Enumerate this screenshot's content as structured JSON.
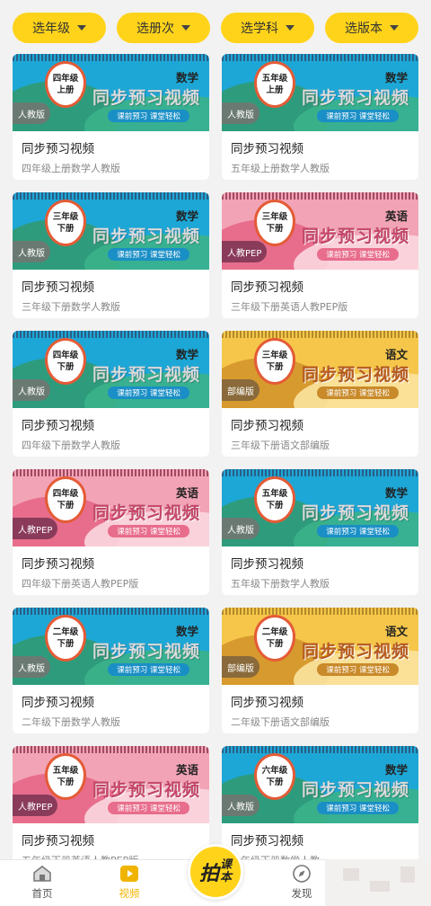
{
  "filters": [
    {
      "label": "选年级"
    },
    {
      "label": "选册次"
    },
    {
      "label": "选学科"
    },
    {
      "label": "选版本"
    }
  ],
  "cards": [
    {
      "theme": "blue",
      "grade": "四年级",
      "term": "上册",
      "subject": "数学",
      "edition": "人教版",
      "banner_title": "同步预习视频",
      "slogan": "课前预习 课堂轻松",
      "title": "同步预习视频",
      "subtitle": "四年级上册数学人教版"
    },
    {
      "theme": "blue",
      "grade": "五年级",
      "term": "上册",
      "subject": "数学",
      "edition": "人教版",
      "banner_title": "同步预习视频",
      "slogan": "课前预习 课堂轻松",
      "title": "同步预习视频",
      "subtitle": "五年级上册数学人教版"
    },
    {
      "theme": "blue",
      "grade": "三年级",
      "term": "下册",
      "subject": "数学",
      "edition": "人教版",
      "banner_title": "同步预习视频",
      "slogan": "课前预习 课堂轻松",
      "title": "同步预习视频",
      "subtitle": "三年级下册数学人教版"
    },
    {
      "theme": "pink",
      "grade": "三年级",
      "term": "下册",
      "subject": "英语",
      "edition": "人教PEP",
      "banner_title": "同步预习视频",
      "slogan": "课前预习 课堂轻松",
      "title": "同步预习视频",
      "subtitle": "三年级下册英语人教PEP版"
    },
    {
      "theme": "blue",
      "grade": "四年级",
      "term": "下册",
      "subject": "数学",
      "edition": "人教版",
      "banner_title": "同步预习视频",
      "slogan": "课前预习 课堂轻松",
      "title": "同步预习视频",
      "subtitle": "四年级下册数学人教版"
    },
    {
      "theme": "yellow",
      "grade": "三年级",
      "term": "下册",
      "subject": "语文",
      "edition": "部编版",
      "banner_title": "同步预习视频",
      "slogan": "课前预习 课堂轻松",
      "title": "同步预习视频",
      "subtitle": "三年级下册语文部编版"
    },
    {
      "theme": "pink",
      "grade": "四年级",
      "term": "下册",
      "subject": "英语",
      "edition": "人教PEP",
      "banner_title": "同步预习视频",
      "slogan": "课前预习 课堂轻松",
      "title": "同步预习视频",
      "subtitle": "四年级下册英语人教PEP版"
    },
    {
      "theme": "blue",
      "grade": "五年级",
      "term": "下册",
      "subject": "数学",
      "edition": "人教版",
      "banner_title": "同步预习视频",
      "slogan": "课前预习 课堂轻松",
      "title": "同步预习视频",
      "subtitle": "五年级下册数学人教版"
    },
    {
      "theme": "blue",
      "grade": "二年级",
      "term": "下册",
      "subject": "数学",
      "edition": "人教版",
      "banner_title": "同步预习视频",
      "slogan": "课前预习 课堂轻松",
      "title": "同步预习视频",
      "subtitle": "二年级下册数学人教版"
    },
    {
      "theme": "yellow",
      "grade": "二年级",
      "term": "下册",
      "subject": "语文",
      "edition": "部编版",
      "banner_title": "同步预习视频",
      "slogan": "课前预习 课堂轻松",
      "title": "同步预习视频",
      "subtitle": "二年级下册语文部编版"
    },
    {
      "theme": "pink",
      "grade": "五年级",
      "term": "下册",
      "subject": "英语",
      "edition": "人教PEP",
      "banner_title": "同步预习视频",
      "slogan": "课前预习 课堂轻松",
      "title": "同步预习视频",
      "subtitle": "五年级下册英语人教PEP版"
    },
    {
      "theme": "blue",
      "grade": "六年级",
      "term": "下册",
      "subject": "数学",
      "edition": "人教版",
      "banner_title": "同步预习视频",
      "slogan": "课前预习 课堂轻松",
      "title": "同步预习视频",
      "subtitle": "六年级下册数学人教"
    }
  ],
  "bottom_nav": {
    "home_label": "首页",
    "video_label": "视频",
    "center_label_main": "拍",
    "center_label_side": "课",
    "center_label_side2": "本",
    "find_label": "发现"
  },
  "colors": {
    "accent_yellow": "#ffd31a",
    "active_nav": "#f0b400"
  }
}
